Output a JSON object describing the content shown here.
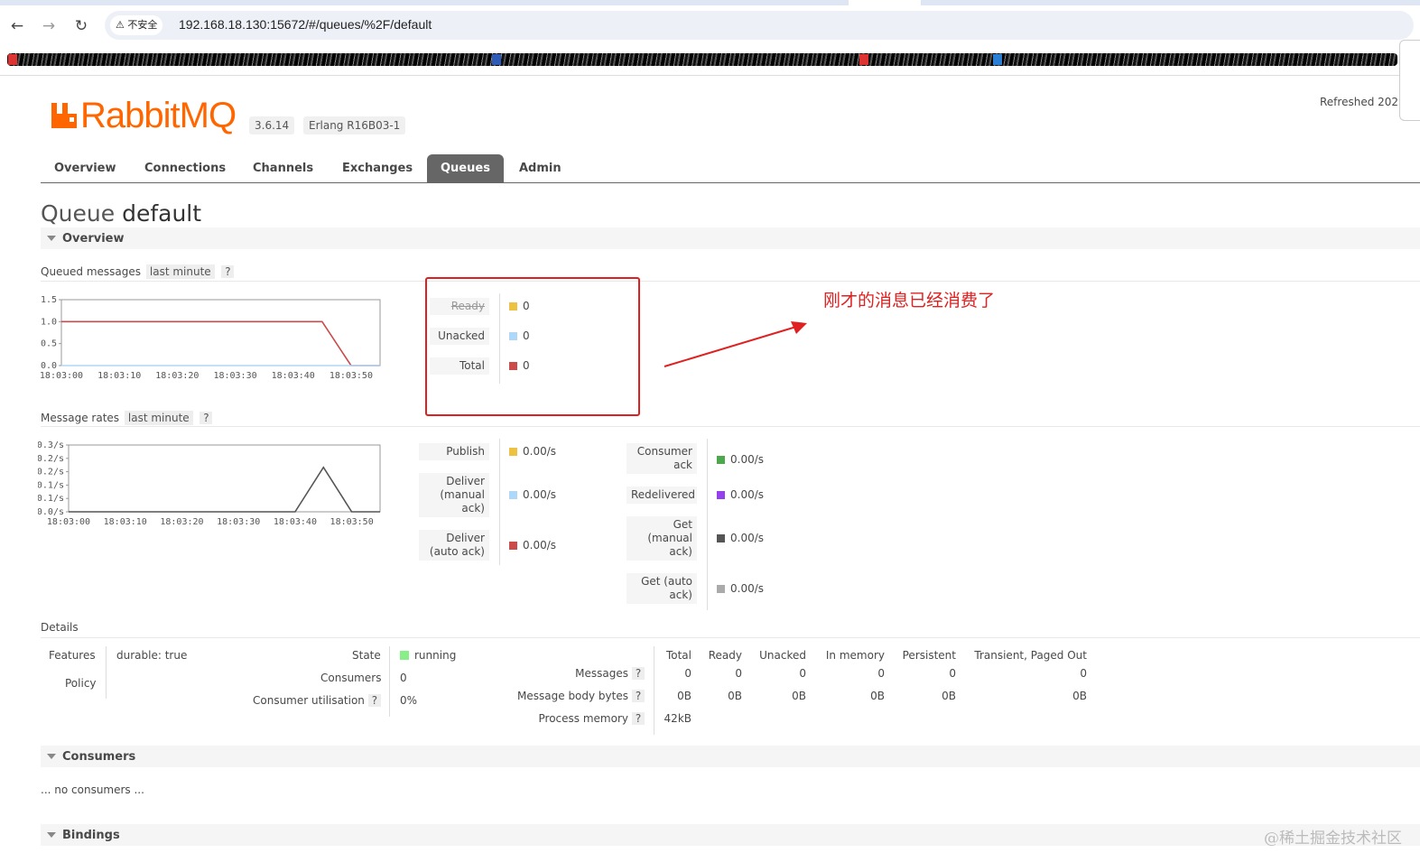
{
  "browser": {
    "security_label": "不安全",
    "url": "192.168.18.130:15672/#/queues/%2F/default"
  },
  "header": {
    "logo_text": "RabbitMQ",
    "version": "3.6.14",
    "erlang": "Erlang R16B03-1",
    "refreshed": "Refreshed 202"
  },
  "tabs": [
    {
      "label": "Overview"
    },
    {
      "label": "Connections"
    },
    {
      "label": "Channels"
    },
    {
      "label": "Exchanges"
    },
    {
      "label": "Queues"
    },
    {
      "label": "Admin"
    }
  ],
  "page": {
    "title_prefix": "Queue",
    "title_name": "default"
  },
  "overview": {
    "section_label": "Overview",
    "queued_label": "Queued messages",
    "queued_range": "last minute",
    "qm": "?",
    "rates_label": "Message rates",
    "rates_range": "last minute"
  },
  "queued_legend": [
    {
      "label": "Ready",
      "value": "0",
      "color": "#edc240"
    },
    {
      "label": "Unacked",
      "value": "0",
      "color": "#afd8f8"
    },
    {
      "label": "Total",
      "value": "0",
      "color": "#cb4b4b"
    }
  ],
  "rates_legend_left": [
    {
      "label": "Publish",
      "value": "0.00/s",
      "color": "#edc240"
    },
    {
      "label": "Deliver (manual ack)",
      "value": "0.00/s",
      "color": "#afd8f8"
    },
    {
      "label": "Deliver (auto ack)",
      "value": "0.00/s",
      "color": "#cb4b4b"
    }
  ],
  "rates_legend_right": [
    {
      "label": "Consumer ack",
      "value": "0.00/s",
      "color": "#4da74d"
    },
    {
      "label": "Redelivered",
      "value": "0.00/s",
      "color": "#9440ed"
    },
    {
      "label": "Get (manual ack)",
      "value": "0.00/s",
      "color": "#555555"
    },
    {
      "label": "Get (auto ack)",
      "value": "0.00/s",
      "color": "#aaaaaa"
    }
  ],
  "chart_data": [
    {
      "type": "line",
      "x": [
        "18:03:00",
        "18:03:10",
        "18:03:20",
        "18:03:30",
        "18:03:40",
        "18:03:50"
      ],
      "yticks": [
        "1.5",
        "1.0",
        "0.5",
        "0.0"
      ],
      "ylim": [
        0,
        1.5
      ],
      "series": [
        {
          "name": "Total",
          "color": "#cb4b4b",
          "points": [
            [
              0,
              1.0
            ],
            [
              45,
              1.0
            ],
            [
              50,
              0.0
            ],
            [
              55,
              0.0
            ]
          ]
        },
        {
          "name": "Unacked",
          "color": "#afd8f8",
          "points": [
            [
              0,
              0.0
            ],
            [
              55,
              0.0
            ]
          ]
        }
      ]
    },
    {
      "type": "line",
      "x": [
        "18:03:00",
        "18:03:10",
        "18:03:20",
        "18:03:30",
        "18:03:40",
        "18:03:50"
      ],
      "yticks": [
        "0.3/s",
        "0.2/s",
        "0.2/s",
        "0.1/s",
        "0.1/s",
        "0.0/s"
      ],
      "ylim": [
        0,
        0.3
      ],
      "series": [
        {
          "name": "Publish",
          "color": "#555555",
          "points": [
            [
              0,
              0.0
            ],
            [
              40,
              0.0
            ],
            [
              45,
              0.2
            ],
            [
              50,
              0.0
            ],
            [
              55,
              0.0
            ]
          ]
        }
      ]
    }
  ],
  "annotation": {
    "text": "刚才的消息已经消费了"
  },
  "details": {
    "label": "Details",
    "features_label": "Features",
    "durable_key": "durable:",
    "durable_val": "true",
    "policy_label": "Policy",
    "state_label": "State",
    "state_val": "running",
    "consumers_label": "Consumers",
    "consumers_val": "0",
    "util_label": "Consumer utilisation",
    "util_val": "0%",
    "columns": [
      "Total",
      "Ready",
      "Unacked",
      "In memory",
      "Persistent",
      "Transient, Paged Out"
    ],
    "rows": [
      {
        "label": "Messages",
        "values": [
          "0",
          "0",
          "0",
          "0",
          "0",
          "0"
        ]
      },
      {
        "label": "Message body bytes",
        "values": [
          "0B",
          "0B",
          "0B",
          "0B",
          "0B",
          "0B"
        ]
      },
      {
        "label": "Process memory",
        "values": [
          "42kB"
        ]
      }
    ]
  },
  "consumers": {
    "section_label": "Consumers",
    "empty": "... no consumers ..."
  },
  "bindings": {
    "section_label": "Bindings"
  },
  "watermark": "@稀土掘金技术社区"
}
